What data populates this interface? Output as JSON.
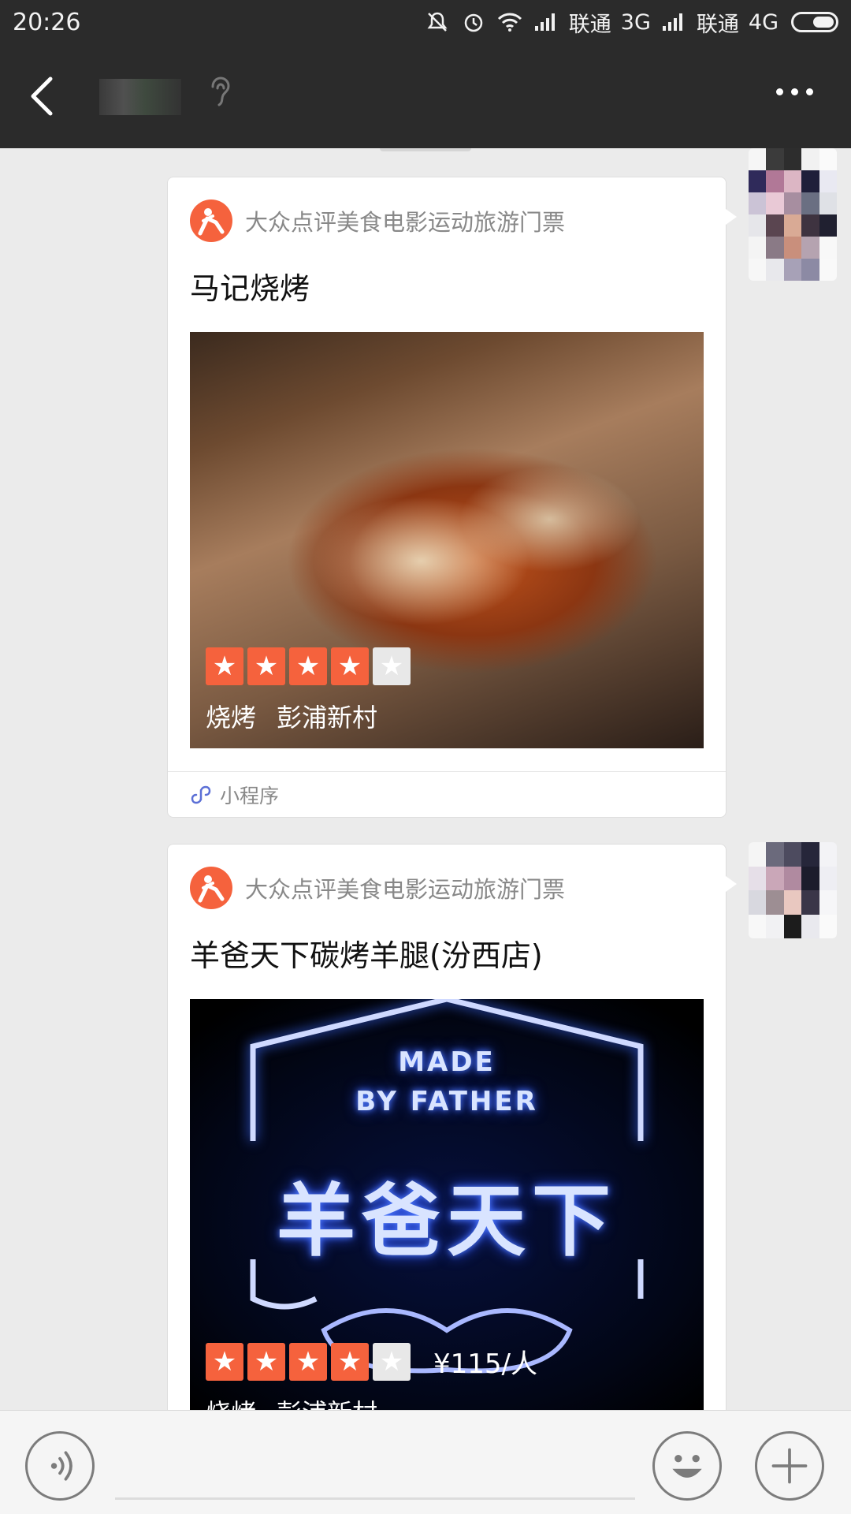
{
  "status_bar": {
    "time": "20:26",
    "carrier_1": "联通",
    "network_1": "3G",
    "carrier_2": "联通",
    "network_2": "4G",
    "icons": [
      "mute-icon",
      "alarm-icon",
      "wifi-icon",
      "signal-icon",
      "battery-icon"
    ]
  },
  "nav": {
    "back_icon": "chevron-left-icon",
    "more_icon": "more-dots-icon",
    "ear_icon": "earpiece-icon"
  },
  "messages": [
    {
      "source": "大众点评美食电影运动旅游门票",
      "title": "马记烧烤",
      "rating": 4,
      "tags": [
        "烧烤",
        "彭浦新村"
      ],
      "footer_label": "小程序",
      "footer_icon": "mini-program-icon"
    },
    {
      "source": "大众点评美食电影运动旅游门票",
      "title": "羊爸天下碳烤羊腿(汾西店)",
      "rating": 4,
      "price": "¥115/人",
      "tags": [
        "烧烤",
        "彭浦新村"
      ],
      "image_text": {
        "line1": "MADE",
        "line2": "BY FATHER",
        "line3": "羊爸天下"
      }
    }
  ],
  "input_bar": {
    "voice_icon": "voice-icon",
    "emoji_icon": "emoji-icon",
    "plus_icon": "plus-icon"
  },
  "colors": {
    "brand_orange": "#f5623d",
    "header_bg": "#2b2b2b",
    "chat_bg": "#ebebeb"
  }
}
